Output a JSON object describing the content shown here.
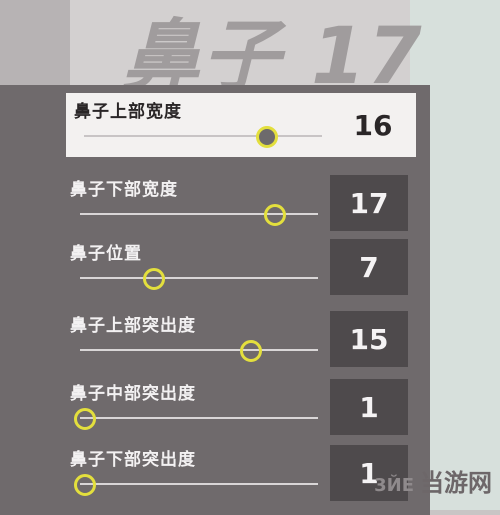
{
  "page_title": "鼻子 17",
  "sliders": [
    {
      "label": "鼻子上部宽度",
      "value": "16",
      "level": 0.77,
      "selected": true
    },
    {
      "label": "鼻子下部宽度",
      "value": "17",
      "level": 0.82,
      "selected": false
    },
    {
      "label": "鼻子位置",
      "value": "7",
      "level": 0.31,
      "selected": false
    },
    {
      "label": "鼻子上部突出度",
      "value": "15",
      "level": 0.72,
      "selected": false
    },
    {
      "label": "鼻子中部突出度",
      "value": "1",
      "level": 0.02,
      "selected": false
    },
    {
      "label": "鼻子下部突出度",
      "value": "1",
      "level": 0.02,
      "selected": false
    }
  ],
  "watermark": {
    "logo": "3ЙЕ",
    "text": "当游网"
  },
  "colors": {
    "accent_knob": "#e3df3d",
    "panel": "#6f6a6c",
    "value_box": "#4e4a4c",
    "selected_row": "#f3f1f0"
  }
}
